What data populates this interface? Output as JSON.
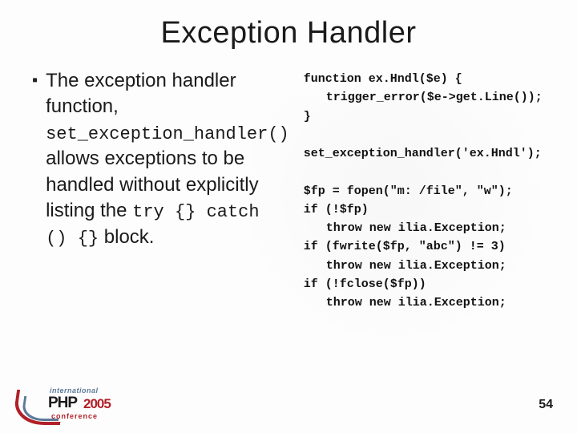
{
  "slide": {
    "title": "Exception Handler",
    "bullet": {
      "t1": "The exception handler function, ",
      "c1": "set_exception_handler()",
      "t2": " allows exceptions to be handled without explicitly listing the ",
      "c2": "try {} catch () {}",
      "t3": " block."
    },
    "code": {
      "l01": "function ex.Hndl($e) {",
      "l02": "trigger_error($e->get.Line());",
      "l03": "}",
      "l04": "set_exception_handler('ex.Hndl');",
      "l05": "$fp = fopen(\"m: /file\", \"w\");",
      "l06": "if (!$fp)",
      "l07": "throw new ilia.Exception;",
      "l08": "if (fwrite($fp, \"abc\") != 3)",
      "l09": "throw new ilia.Exception;",
      "l10": "if (!fclose($fp))",
      "l11": "throw new ilia.Exception;"
    }
  },
  "footer": {
    "logo_top": "international",
    "logo_main": "PHP",
    "logo_year": "2005",
    "logo_bottom": "conference",
    "page_number": "54"
  }
}
